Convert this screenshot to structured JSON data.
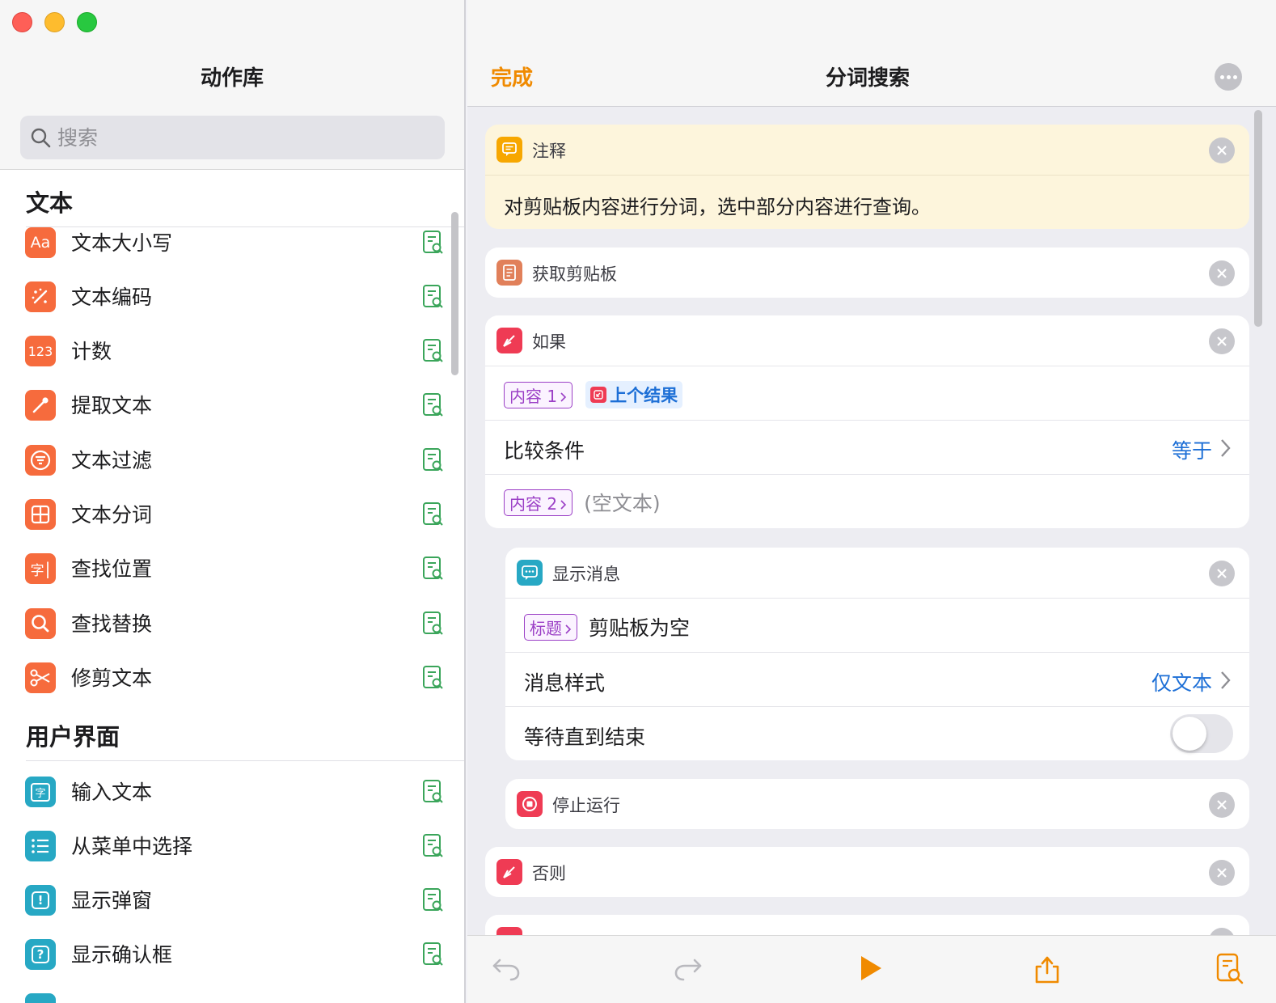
{
  "window": {
    "controls": [
      "close",
      "minimize",
      "zoom"
    ]
  },
  "library": {
    "title": "动作库",
    "search": {
      "placeholder": "搜索",
      "value": ""
    },
    "sections": [
      {
        "title": "文本",
        "items": [
          {
            "label": "文本大小写",
            "icon": "Aa"
          },
          {
            "label": "文本编码",
            "icon": "magic-wand-icon"
          },
          {
            "label": "计数",
            "icon": "123"
          },
          {
            "label": "提取文本",
            "icon": "eyedropper-icon"
          },
          {
            "label": "文本过滤",
            "icon": "filter-icon"
          },
          {
            "label": "文本分词",
            "icon": "grid-icon"
          },
          {
            "label": "查找位置",
            "icon": "字"
          },
          {
            "label": "查找替换",
            "icon": "search-icon"
          },
          {
            "label": "修剪文本",
            "icon": "scissors-icon"
          }
        ]
      },
      {
        "title": "用户界面",
        "items": [
          {
            "label": "输入文本",
            "icon": "字"
          },
          {
            "label": "从菜单中选择",
            "icon": "list-icon"
          },
          {
            "label": "显示弹窗",
            "icon": "!"
          },
          {
            "label": "显示确认框",
            "icon": "?"
          }
        ]
      }
    ]
  },
  "workflow": {
    "done_label": "完成",
    "title": "分词搜索",
    "comment": {
      "title": "注释",
      "text": "对剪贴板内容进行分词，选中部分内容进行查询。"
    },
    "get_clipboard": {
      "title": "获取剪贴板"
    },
    "if_block": {
      "title": "如果",
      "content1_label": "内容 1",
      "content1_value": "上个结果",
      "compare_label": "比较条件",
      "compare_value": "等于",
      "content2_label": "内容 2",
      "content2_value": "(空文本)"
    },
    "show_message": {
      "title": "显示消息",
      "title_token": "标题",
      "title_value": "剪贴板为空",
      "style_label": "消息样式",
      "style_value": "仅文本",
      "wait_label": "等待直到结束",
      "wait_enabled": false
    },
    "stop": {
      "title": "停止运行"
    },
    "otherwise": {
      "title": "否则"
    }
  },
  "colors": {
    "accent": "#f08a00",
    "link": "#1d6fd6",
    "orange_icon": "#f66b3d",
    "teal_icon": "#27a8c4",
    "comment_bg": "#fdf5dc"
  }
}
